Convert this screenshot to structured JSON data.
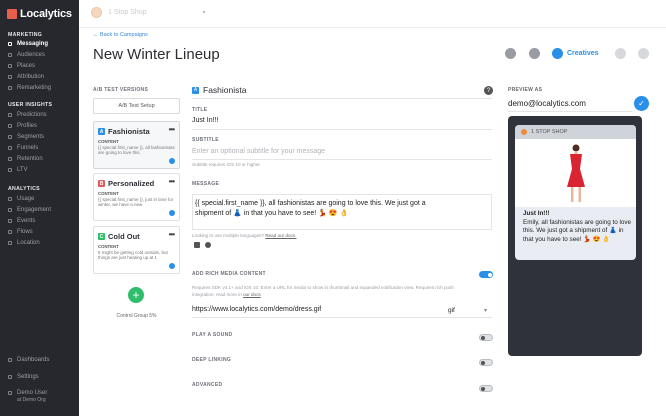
{
  "brand": "Localytics",
  "app": {
    "name": "1 Stop Shop"
  },
  "sidebar": {
    "sections": [
      "MARKETING",
      "USER INSIGHTS",
      "ANALYTICS"
    ],
    "marketing": [
      "Messaging",
      "Audiences",
      "Places",
      "Attribution",
      "Remarketing"
    ],
    "insights": [
      "Predictions",
      "Profiles",
      "Segments",
      "Funnels",
      "Retention",
      "LTV"
    ],
    "analytics": [
      "Usage",
      "Engagement",
      "Events",
      "Flows",
      "Location"
    ],
    "bottom": [
      "Dashboards",
      "Settings"
    ],
    "user": "Demo User",
    "org": "at Demo Org"
  },
  "header": {
    "back": "Back to Campaigns",
    "title": "New Winter Lineup",
    "creatives": "Creatives"
  },
  "ab": {
    "label": "A/B TEST VERSIONS",
    "setup": "A/B Test Setup",
    "content_label": "CONTENT",
    "versions": [
      {
        "badge": "A",
        "name": "Fashionista",
        "text": "{{ special.first_name }}, all fashionistas are going to love this.",
        "color": "#2a8fe8"
      },
      {
        "badge": "B",
        "name": "Personalized",
        "text": "{{ special.first_name }}, just in time for winter, we have a new",
        "color": "#e25a5a"
      },
      {
        "badge": "C",
        "name": "Cold Out",
        "text": "It might be getting cold outside, but things are just heating up at 1",
        "color": "#2fbe6b"
      }
    ],
    "control": "Control Group 5%"
  },
  "editor": {
    "name": "Fashionista",
    "title_label": "TITLE",
    "title_value": "Just In!!!",
    "subtitle_label": "SUBTITLE",
    "subtitle_placeholder": "Enter an optional subtitle for your message",
    "subtitle_hint": "Subtitle requires iOS 10 or higher.",
    "message_label": "MESSAGE",
    "message_line1": "{{ special.first_name }}, all fashionistas are going to love this. We just got a",
    "message_line2": "shipment of 👗 in that you have to see!  💃 😍 👌",
    "lang_hint": "Looking to use multiple languages?",
    "lang_link": "Read our docs.",
    "rich_label": "ADD RICH MEDIA CONTENT",
    "rich_hint1": "Requires SDK v4.1+ and iOS 10. Enter a URL for media to show in thumbnail and expanded notification view. Requires rich push",
    "rich_hint2": "integration, read more in",
    "rich_link": "our docs",
    "url": "https://www.localytics.com/demo/dress.gif",
    "media_type": "gif",
    "sound_label": "PLAY A SOUND",
    "deeplink_label": "DEEP LINKING",
    "advanced_label": "ADVANCED"
  },
  "preview": {
    "label": "PREVIEW AS",
    "email": "demo@localytics.com",
    "app_name": "1 STOP SHOP",
    "title": "Just In!!!",
    "body": "Emily, all fashionistas are going to love this. We just got a shipment of 👗 in that you have to see! 💃 😍 👌"
  },
  "toggles": {
    "rich": true,
    "sound": false,
    "deeplink": false,
    "advanced": false
  }
}
